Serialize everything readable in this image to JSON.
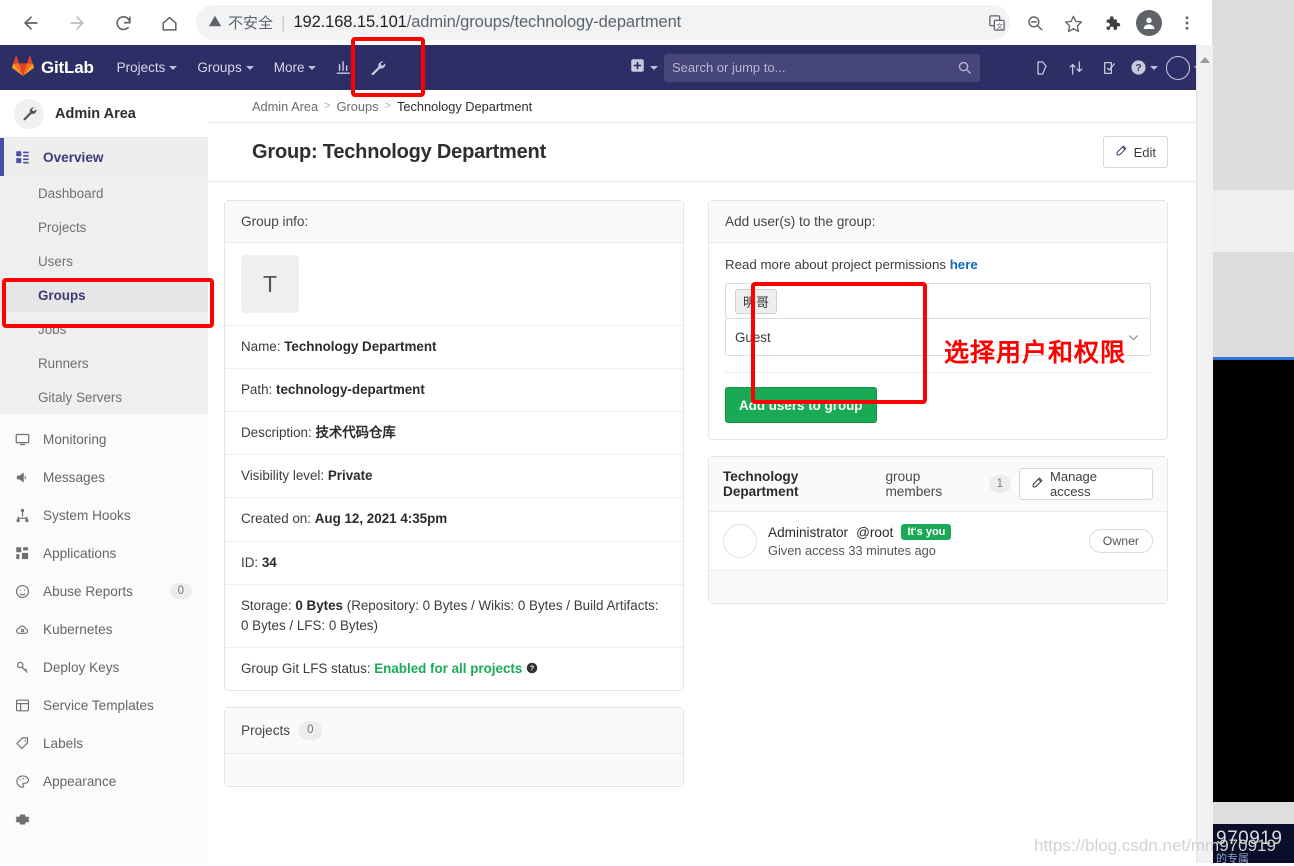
{
  "browser": {
    "back_icon": "back-arrow-icon",
    "forward_icon": "forward-arrow-icon",
    "reload_icon": "reload-icon",
    "home_icon": "home-icon",
    "security_label": "不安全",
    "url_host": "192.168.15.101",
    "url_path": "/admin/groups/technology-department",
    "translate_icon": "translate-icon",
    "zoom_out_icon": "zoom-out-icon",
    "bookmark_icon": "star-icon",
    "extensions_icon": "puzzle-icon",
    "profile_icon": "profile-avatar-icon",
    "menu_icon": "three-dot-menu-icon"
  },
  "topnav": {
    "brand": "GitLab",
    "brand_icon": "gitlab-tanuki-icon",
    "items": [
      {
        "label": "Projects",
        "caret": true
      },
      {
        "label": "Groups",
        "caret": true
      },
      {
        "label": "More",
        "caret": true
      }
    ],
    "chart_icon": "analytics-chart-icon",
    "wrench_icon": "admin-wrench-icon",
    "plus_icon": "plus-square-icon",
    "search_placeholder": "Search or jump to...",
    "search_icon": "search-icon",
    "right_icons": [
      "issues-icon",
      "merge-requests-icon",
      "todos-icon",
      "help-icon",
      "user-avatar-icon"
    ]
  },
  "sidebar": {
    "title": "Admin Area",
    "title_icon": "wrench-icon",
    "overview": {
      "label": "Overview",
      "icon": "overview-grid-icon"
    },
    "sub_items": [
      {
        "label": "Dashboard",
        "active": false
      },
      {
        "label": "Projects",
        "active": false
      },
      {
        "label": "Users",
        "active": false
      },
      {
        "label": "Groups",
        "active": true
      },
      {
        "label": "Jobs",
        "active": false
      },
      {
        "label": "Runners",
        "active": false
      },
      {
        "label": "Gitaly Servers",
        "active": false
      }
    ],
    "items": [
      {
        "label": "Monitoring",
        "icon": "monitor-icon",
        "count": ""
      },
      {
        "label": "Messages",
        "icon": "megaphone-icon",
        "count": ""
      },
      {
        "label": "System Hooks",
        "icon": "hooks-icon",
        "count": ""
      },
      {
        "label": "Applications",
        "icon": "applications-grid-icon",
        "count": ""
      },
      {
        "label": "Abuse Reports",
        "icon": "sad-face-icon",
        "count": "0"
      },
      {
        "label": "Kubernetes",
        "icon": "kubernetes-cloud-icon",
        "count": ""
      },
      {
        "label": "Deploy Keys",
        "icon": "key-icon",
        "count": ""
      },
      {
        "label": "Service Templates",
        "icon": "template-icon",
        "count": ""
      },
      {
        "label": "Labels",
        "icon": "label-tag-icon",
        "count": ""
      },
      {
        "label": "Appearance",
        "icon": "palette-icon",
        "count": ""
      }
    ]
  },
  "breadcrumb": {
    "root": "Admin Area",
    "level2": "Groups",
    "current": "Technology Department"
  },
  "page": {
    "title": "Group: Technology Department",
    "edit_label": "Edit",
    "edit_icon": "pencil-edit-icon"
  },
  "group_info": {
    "header": "Group info:",
    "avatar_letter": "T",
    "rows": [
      {
        "label": "Name:",
        "value": "Technology Department"
      },
      {
        "label": "Path:",
        "value": "technology-department"
      },
      {
        "label": "Description:",
        "value": "技术代码仓库"
      },
      {
        "label": "Visibility level:",
        "value": "Private"
      },
      {
        "label": "Created on:",
        "value": "Aug 12, 2021 4:35pm"
      },
      {
        "label": "ID:",
        "value": "34"
      }
    ],
    "storage_label": "Storage:",
    "storage_value": "0 Bytes",
    "storage_detail": "(Repository: 0 Bytes / Wikis: 0 Bytes / Build Artifacts: 0 Bytes / LFS: 0 Bytes)",
    "lfs_label": "Group Git LFS status:",
    "lfs_value": "Enabled for all projects",
    "lfs_help_icon": "question-mark-icon"
  },
  "projects_card": {
    "title": "Projects",
    "count": "0"
  },
  "add_users": {
    "header": "Add user(s) to the group:",
    "hint_text": "Read more about project permissions",
    "hint_link": "here",
    "user_token": "明哥",
    "access_level": "Guest",
    "dropdown_icon": "chevron-down-icon",
    "submit_label": "Add users to group"
  },
  "members": {
    "group_name": "Technology Department",
    "title_suffix": "group members",
    "count": "1",
    "manage_label": "Manage access",
    "manage_icon": "pencil-edit-icon",
    "rows": [
      {
        "name": "Administrator",
        "handle": "@root",
        "its_you": "It's you",
        "subtext": "Given access 33 minutes ago",
        "role": "Owner"
      }
    ]
  },
  "annotations": {
    "chinese_note": "选择用户和权限",
    "accent_red": "#fe0000"
  },
  "watermark": {
    "text": "https://blog.csdn.net/mm970919"
  },
  "background_window": {
    "overlay_number": "970919",
    "overlay_text": "的专属"
  }
}
